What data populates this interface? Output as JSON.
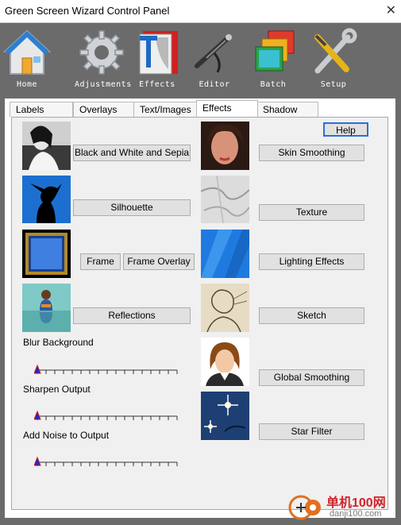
{
  "window": {
    "title": "Green Screen Wizard Control Panel"
  },
  "toolbar": {
    "items": [
      {
        "label": "Home",
        "icon": "house-icon"
      },
      {
        "label": "Adjustments",
        "icon": "gear-icon"
      },
      {
        "label": "Effects",
        "icon": "effects-icon"
      },
      {
        "label": "Editor",
        "icon": "airbrush-icon"
      },
      {
        "label": "Batch",
        "icon": "stack-icon"
      },
      {
        "label": "Setup",
        "icon": "tools-icon"
      }
    ]
  },
  "tabs": [
    {
      "label": "Labels"
    },
    {
      "label": "Overlays"
    },
    {
      "label": "Text/Images"
    },
    {
      "label": "Effects",
      "active": true
    },
    {
      "label": "Shadow"
    }
  ],
  "help": "Help",
  "effects_left": {
    "bw_sepia": "Black and White and Sepia",
    "silhouette": "Silhouette",
    "frame": "Frame",
    "frame_overlay": "Frame Overlay",
    "reflections": "Reflections"
  },
  "effects_right": {
    "skin_smoothing": "Skin Smoothing",
    "texture": "Texture",
    "lighting": "Lighting Effects",
    "sketch": "Sketch",
    "global_smoothing": "Global Smoothing",
    "star_filter": "Star Filter"
  },
  "sliders": [
    {
      "label": "Blur Background",
      "value": 0
    },
    {
      "label": "Sharpen Output",
      "value": 0
    },
    {
      "label": "Add Noise to Output",
      "value": 0
    }
  ],
  "watermark": {
    "text": "单机100网",
    "url": "danji100.com"
  }
}
